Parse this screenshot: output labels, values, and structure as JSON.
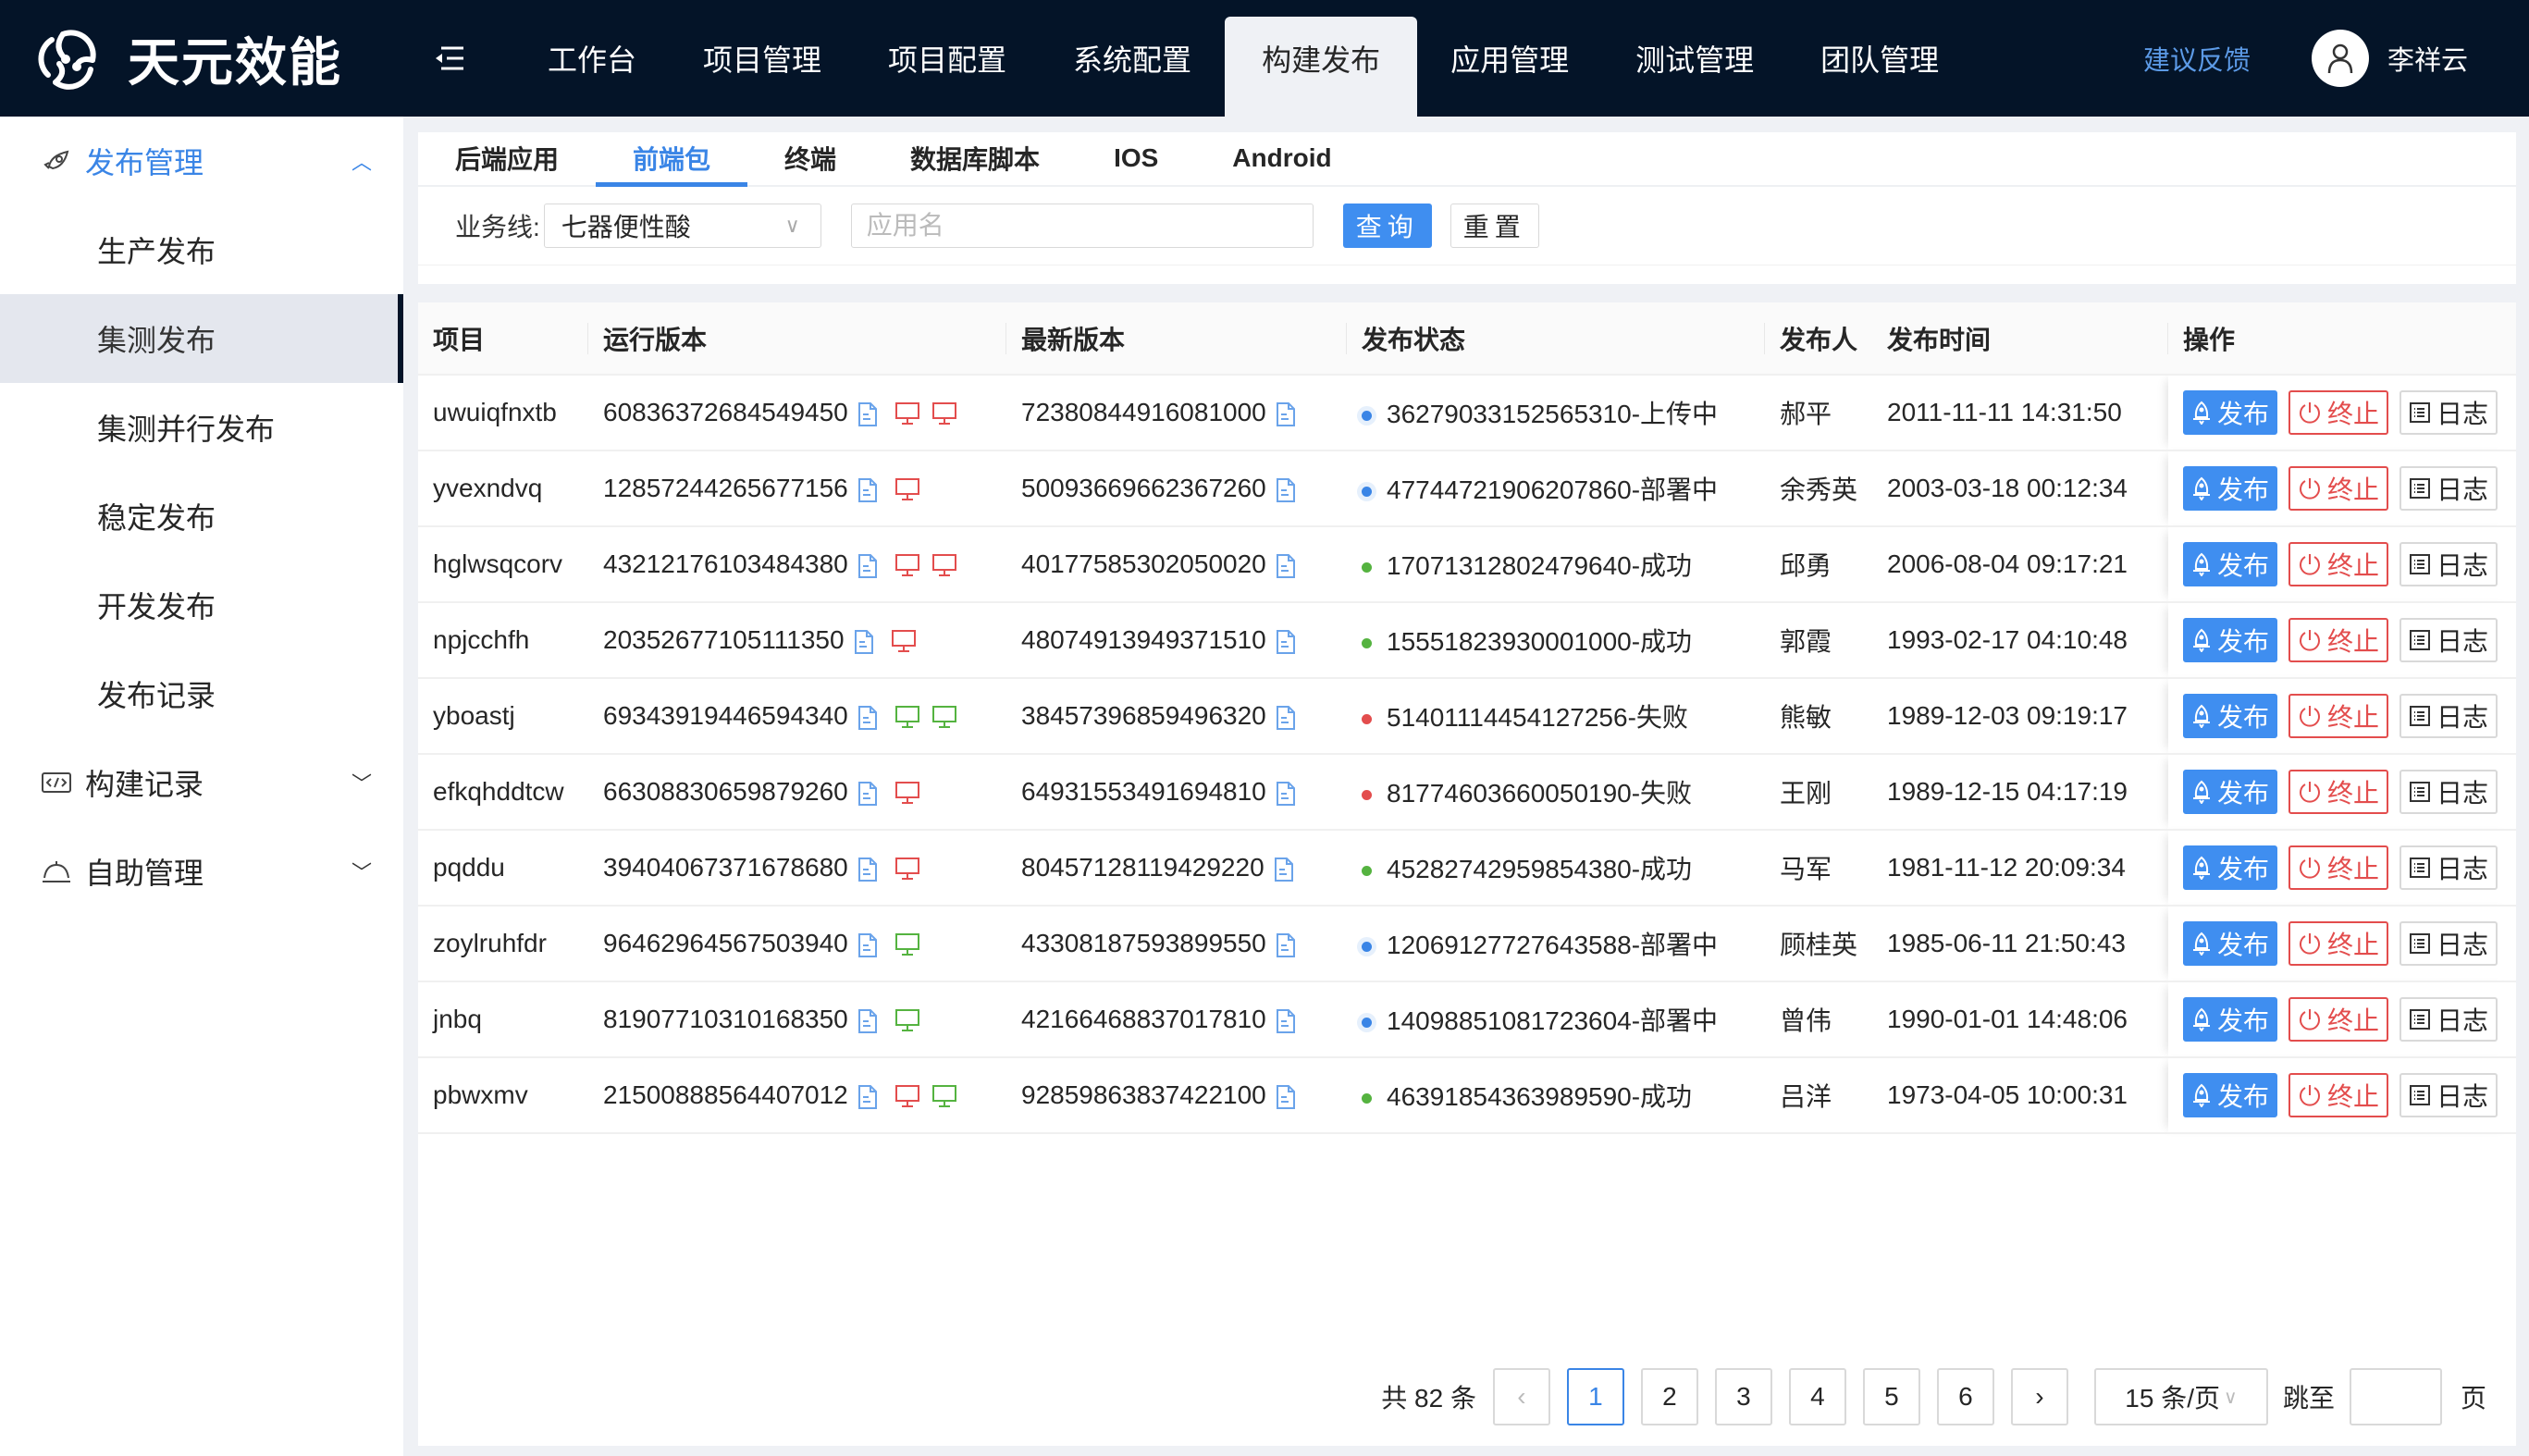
{
  "header": {
    "app_name": "天元效能",
    "nav": [
      "工作台",
      "项目管理",
      "项目配置",
      "系统配置",
      "构建发布",
      "应用管理",
      "测试管理",
      "团队管理"
    ],
    "active_nav": 4,
    "feedback": "建议反馈",
    "username": "李祥云"
  },
  "sidebar": {
    "groups": [
      {
        "label": "发布管理",
        "icon": "rocket-icon",
        "open": true,
        "items": [
          "生产发布",
          "集测发布",
          "集测并行发布",
          "稳定发布",
          "开发发布",
          "发布记录"
        ],
        "active_item": 1
      },
      {
        "label": "构建记录",
        "icon": "code-icon",
        "open": false
      },
      {
        "label": "自助管理",
        "icon": "service-bell-icon",
        "open": false
      }
    ]
  },
  "tabs": [
    "后端应用",
    "前端包",
    "终端",
    "数据库脚本",
    "IOS",
    "Android"
  ],
  "active_tab": 1,
  "filters": {
    "business_line_label": "业务线:",
    "business_line_value": "七器便性酸",
    "app_name_placeholder": "应用名",
    "query_label": "查询",
    "reset_label": "重置"
  },
  "table": {
    "columns": [
      "项目",
      "运行版本",
      "最新版本",
      "发布状态",
      "发布人",
      "发布时间",
      "操作"
    ],
    "actions": {
      "publish": "发布",
      "stop": "终止",
      "log": "日志"
    },
    "colors": {
      "green": "#55b340",
      "red": "#e34d4d",
      "blue": "#3a85e6"
    },
    "rows": [
      {
        "project": "uwuiqfnxtb",
        "running": "60836372684549450",
        "envs": [
          "red",
          "red"
        ],
        "latest": "72380844916081000",
        "status": "36279033152565310-上传中",
        "status_color": "blue",
        "publisher": "郝平",
        "time": "2011-11-11 14:31:50"
      },
      {
        "project": "yvexndvq",
        "running": "12857244265677156",
        "envs": [
          "red"
        ],
        "latest": "50093669662367260",
        "status": "47744721906207860-部署中",
        "status_color": "blue",
        "publisher": "余秀英",
        "time": "2003-03-18 00:12:34"
      },
      {
        "project": "hglwsqcorv",
        "running": "43212176103484380",
        "envs": [
          "red",
          "red"
        ],
        "latest": "40177585302050020",
        "status": "17071312802479640-成功",
        "status_color": "green",
        "publisher": "邱勇",
        "time": "2006-08-04 09:17:21"
      },
      {
        "project": "npjcchfh",
        "running": "20352677105111350",
        "envs": [
          "red"
        ],
        "latest": "48074913949371510",
        "status": "15551823930001000-成功",
        "status_color": "green",
        "publisher": "郭霞",
        "time": "1993-02-17 04:10:48"
      },
      {
        "project": "yboastj",
        "running": "69343919446594340",
        "envs": [
          "green",
          "green"
        ],
        "latest": "38457396859496320",
        "status": "51401114454127256-失败",
        "status_color": "red",
        "publisher": "熊敏",
        "time": "1989-12-03 09:19:17"
      },
      {
        "project": "efkqhddtcw",
        "running": "66308830659879260",
        "envs": [
          "red"
        ],
        "latest": "64931553491694810",
        "status": "81774603660050190-失败",
        "status_color": "red",
        "publisher": "王刚",
        "time": "1989-12-15 04:17:19"
      },
      {
        "project": "pqddu",
        "running": "39404067371678680",
        "envs": [
          "red"
        ],
        "latest": "80457128119429220",
        "status": "45282742959854380-成功",
        "status_color": "green",
        "publisher": "马军",
        "time": "1981-11-12 20:09:34"
      },
      {
        "project": "zoylruhfdr",
        "running": "96462964567503940",
        "envs": [
          "green"
        ],
        "latest": "43308187593899550",
        "status": "12069127727643588-部署中",
        "status_color": "blue",
        "publisher": "顾桂英",
        "time": "1985-06-11 21:50:43"
      },
      {
        "project": "jnbq",
        "running": "81907710310168350",
        "envs": [
          "green"
        ],
        "latest": "42166468837017810",
        "status": "14098851081723604-部署中",
        "status_color": "blue",
        "publisher": "曾伟",
        "time": "1990-01-01 14:48:06"
      },
      {
        "project": "pbwxmv",
        "running": "21500888564407012",
        "envs": [
          "red",
          "green"
        ],
        "latest": "92859863837422100",
        "status": "46391854363989590-成功",
        "status_color": "green",
        "publisher": "吕洋",
        "time": "1973-04-05 10:00:31"
      }
    ]
  },
  "pagination": {
    "total": "共 82 条",
    "pages": [
      "1",
      "2",
      "3",
      "4",
      "5",
      "6"
    ],
    "current": "1",
    "page_size": "15 条/页",
    "jump_label": "跳至",
    "page_suffix": "页"
  }
}
